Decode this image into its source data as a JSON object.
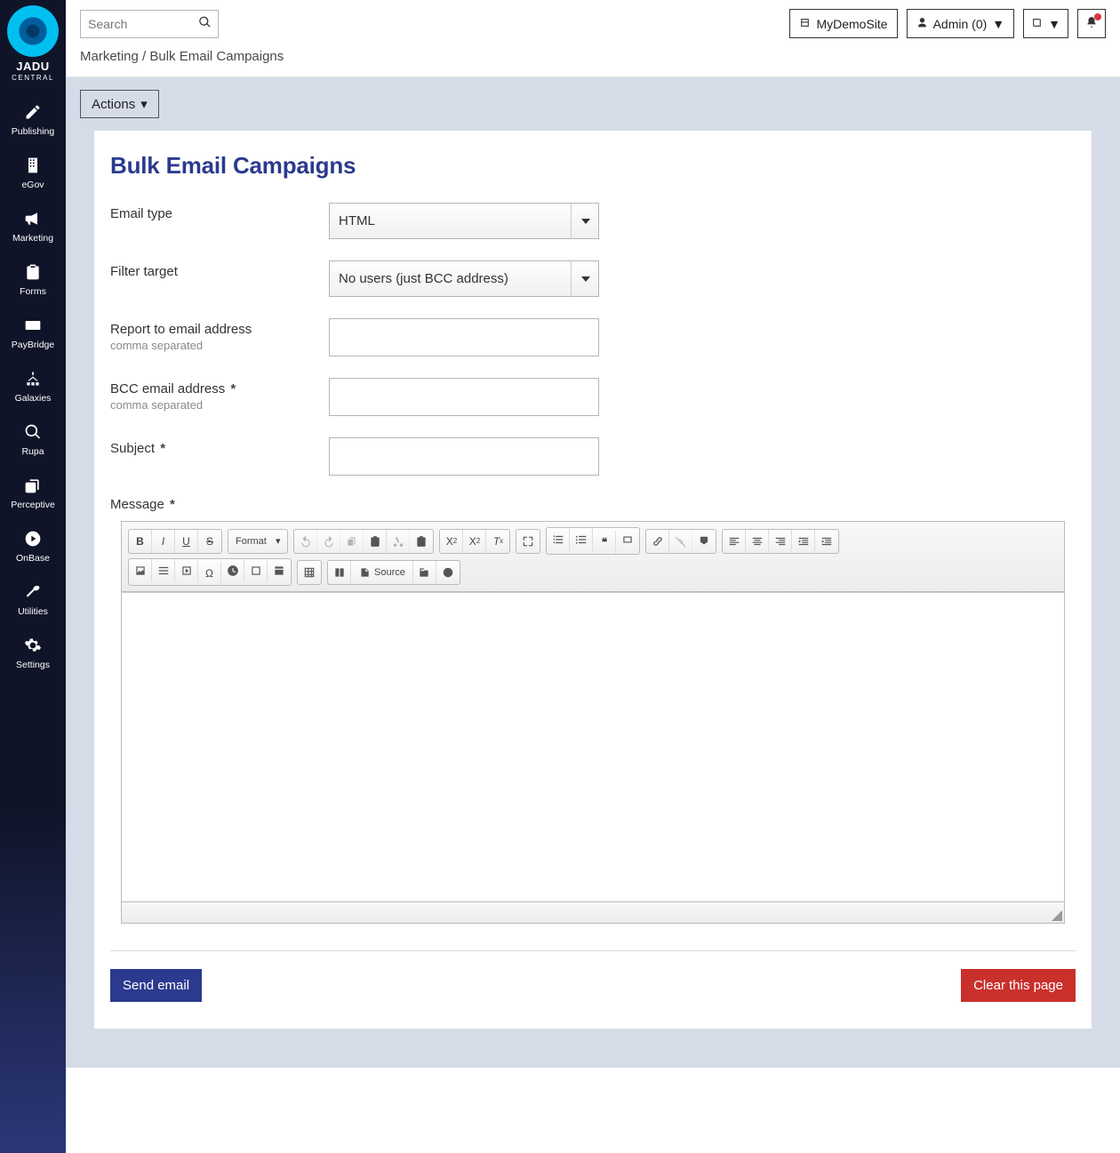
{
  "brand": {
    "name": "JADU",
    "sub": "CENTRAL"
  },
  "sidebar": {
    "items": [
      {
        "label": "Publishing"
      },
      {
        "label": "eGov"
      },
      {
        "label": "Marketing"
      },
      {
        "label": "Forms"
      },
      {
        "label": "PayBridge"
      },
      {
        "label": "Galaxies"
      },
      {
        "label": "Rupa"
      },
      {
        "label": "Perceptive"
      },
      {
        "label": "OnBase"
      },
      {
        "label": "Utilities"
      },
      {
        "label": "Settings"
      }
    ]
  },
  "topbar": {
    "search_placeholder": "Search",
    "site_name": "MyDemoSite",
    "admin_label": "Admin (0)"
  },
  "breadcrumb": {
    "parent": "Marketing",
    "sep": "/",
    "current": "Bulk Email Campaigns"
  },
  "toolbar": {
    "actions_label": "Actions"
  },
  "page": {
    "title": "Bulk Email Campaigns"
  },
  "form": {
    "email_type": {
      "label": "Email type",
      "value": "HTML"
    },
    "filter_target": {
      "label": "Filter target",
      "value": "No users (just BCC address)"
    },
    "report_to": {
      "label": "Report to email address",
      "hint": "comma separated",
      "value": ""
    },
    "bcc": {
      "label": "BCC email address",
      "hint": "comma separated",
      "value": ""
    },
    "subject": {
      "label": "Subject",
      "value": ""
    },
    "message": {
      "label": "Message"
    },
    "format_label": "Format",
    "source_label": "Source"
  },
  "buttons": {
    "send": "Send email",
    "clear": "Clear this page"
  }
}
